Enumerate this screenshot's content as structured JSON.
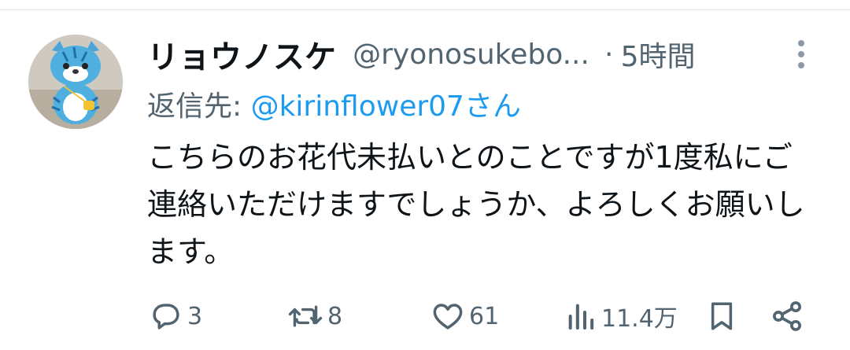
{
  "tweet": {
    "display_name": "リョウノスケ",
    "handle": "@ryonosukebo...",
    "separator": "·",
    "time": "5時間",
    "reply_prefix": "返信先: ",
    "reply_mention": "@kirinflower07さん",
    "text": "こちらのお花代未払いとのことですが1度私にご連絡いただけますでしょうか、よろしくお願いします。"
  },
  "actions": {
    "reply_count": "3",
    "retweet_count": "8",
    "like_count": "61",
    "view_count": "11.4万"
  },
  "colors": {
    "link": "#1d9bf0",
    "secondary": "#536471",
    "primary_text": "#0f1419"
  },
  "icons": [
    "avatar-image",
    "more-options-icon",
    "reply-icon",
    "retweet-icon",
    "like-icon",
    "views-icon",
    "bookmark-icon",
    "share-icon"
  ]
}
